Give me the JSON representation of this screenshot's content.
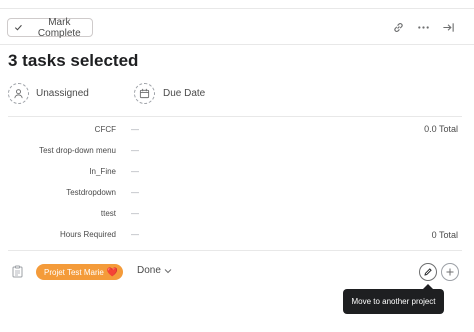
{
  "toolbar": {
    "mark_complete_label": "Mark Complete",
    "icons": [
      "link-icon",
      "more-icon",
      "close-panel-icon"
    ]
  },
  "title": "3 tasks selected",
  "assignee": {
    "label": "Unassigned",
    "icon": "person-icon"
  },
  "due_date": {
    "label": "Due Date",
    "icon": "calendar-icon"
  },
  "fields": [
    {
      "name": "CFCF",
      "value": "—",
      "total": "0.0 Total"
    },
    {
      "name": "Test drop-down menu",
      "value": "—",
      "total": ""
    },
    {
      "name": "In_Fine",
      "value": "—",
      "total": ""
    },
    {
      "name": "Testdropdown",
      "value": "—",
      "total": ""
    },
    {
      "name": "ttest",
      "value": "—",
      "total": ""
    },
    {
      "name": "Hours Required",
      "value": "—",
      "total": "0 Total"
    }
  ],
  "project": {
    "name": "Projet Test Marie",
    "emoji": "❤️",
    "color": "#f49b3a",
    "status": "Done"
  },
  "tooltip": "Move to another project",
  "colors": {
    "text": "#1e1f21",
    "muted": "#4b4b4b",
    "border": "#e8e8e8"
  }
}
